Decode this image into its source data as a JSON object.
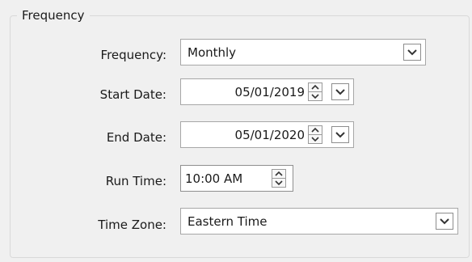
{
  "group": {
    "title": "Frequency"
  },
  "frequency": {
    "label": "Frequency:",
    "value": "Monthly"
  },
  "start_date": {
    "label": "Start Date:",
    "value": "05/01/2019"
  },
  "end_date": {
    "label": "End Date:",
    "value": "05/01/2020"
  },
  "run_time": {
    "label": "Run Time:",
    "value": "10:00 AM"
  },
  "time_zone": {
    "label": "Time Zone:",
    "value": "Eastern Time"
  },
  "icons": {
    "dropdown": "chevron-down-icon",
    "spin_up": "chevron-up-icon",
    "spin_down": "chevron-down-icon"
  },
  "colors": {
    "background": "#f0f0f0",
    "field_background": "#ffffff",
    "field_border": "#a7a7a7",
    "group_border": "#d9d9d9",
    "text": "#1a1a1a"
  }
}
